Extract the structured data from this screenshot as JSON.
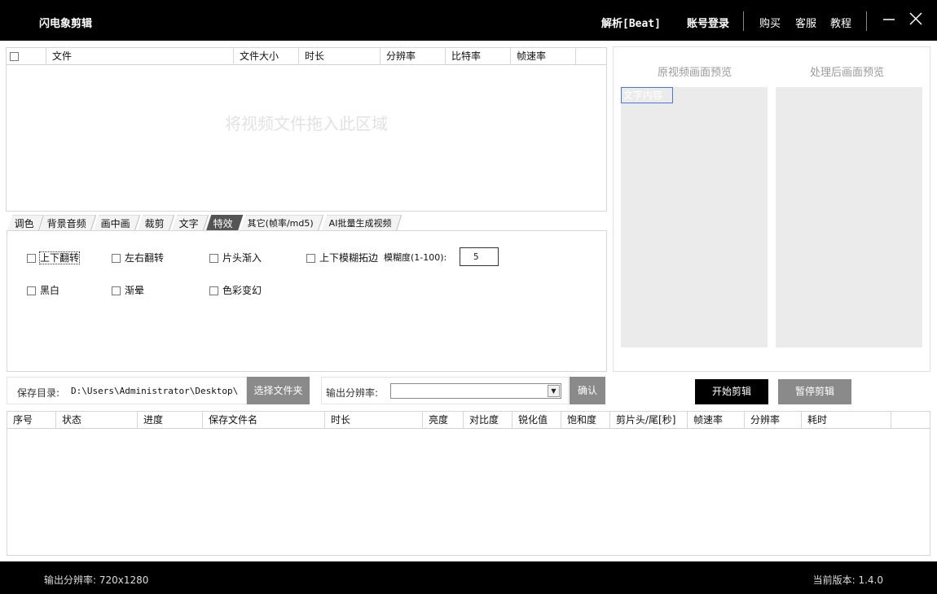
{
  "titlebar": {
    "app_title": "闪电象剪辑",
    "parse_label": "解析[Beat]",
    "login_label": "账号登录",
    "buy_label": "购买",
    "service_label": "客服",
    "tutorial_label": "教程"
  },
  "file_list": {
    "columns": [
      "",
      "文件",
      "文件大小",
      "时长",
      "分辨率",
      "比特率",
      "帧速率"
    ],
    "drop_hint": "将视频文件拖入此区域"
  },
  "tabs": [
    {
      "label": "调色",
      "active": false
    },
    {
      "label": "背景音频",
      "active": false
    },
    {
      "label": "画中画",
      "active": false
    },
    {
      "label": "裁剪",
      "active": false
    },
    {
      "label": "文字",
      "active": false
    },
    {
      "label": "特效",
      "active": true
    },
    {
      "label": "其它(帧率/md5)",
      "active": false
    },
    {
      "label": "AI批量生成视频",
      "active": false
    }
  ],
  "effects": {
    "flip_vertical": "上下翻转",
    "flip_horizontal": "左右翻转",
    "fade_in": "片头渐入",
    "blur_edges": "上下模糊拓边",
    "blur_level_label": "模糊度(1-100):",
    "blur_level_value": "5",
    "black_white": "黑白",
    "vignette": "渐晕",
    "color_shift": "色彩变幻"
  },
  "save": {
    "label": "保存目录:",
    "path": "D:\\Users\\Administrator\\Desktop\\",
    "choose_folder_label": "选择文件夹"
  },
  "output": {
    "resolution_label": "输出分辨率:",
    "resolution_value": "",
    "confirm_label": "确认"
  },
  "preview": {
    "original_title": "原视频画面预览",
    "processed_title": "处理后画面预览",
    "text_overlay": "文字内容"
  },
  "actions": {
    "start_label": "开始剪辑",
    "pause_label": "暂停剪辑"
  },
  "task_list": {
    "columns": [
      "序号",
      "状态",
      "进度",
      "保存文件名",
      "时长",
      "亮度",
      "对比度",
      "锐化值",
      "饱和度",
      "剪片头/尾[秒]",
      "帧速率",
      "分辨率",
      "耗时"
    ]
  },
  "statusbar": {
    "output_resolution": "输出分辨率: 720x1280",
    "version": "当前版本: 1.4.0"
  }
}
